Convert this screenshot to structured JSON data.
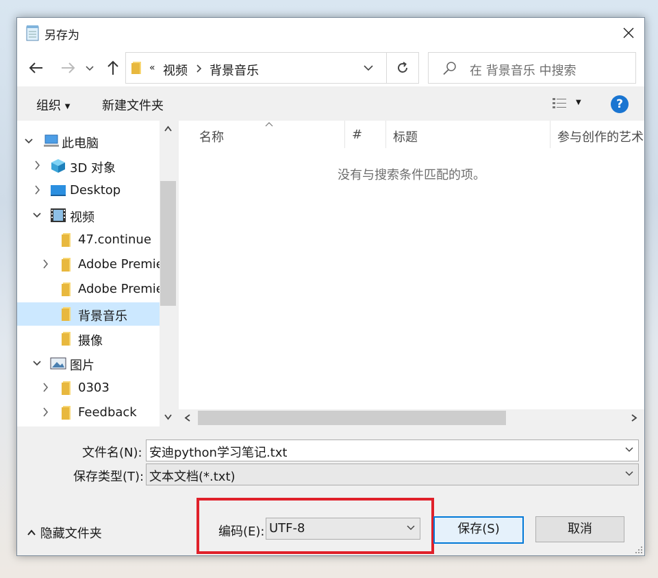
{
  "dialog": {
    "title": "另存为"
  },
  "address": {
    "overflow": "«",
    "crumbs": [
      "视频",
      "背景音乐"
    ]
  },
  "search": {
    "placeholder": "在 背景音乐 中搜索"
  },
  "toolbar": {
    "organize": "组织",
    "new_folder": "新建文件夹",
    "help": "?"
  },
  "nav": {
    "items": [
      {
        "label": "此电脑",
        "icon": "computer-icon"
      },
      {
        "label": "3D 对象",
        "icon": "3d-objects-icon"
      },
      {
        "label": "Desktop",
        "icon": "desktop-icon"
      },
      {
        "label": "视频",
        "icon": "video-folder-icon"
      },
      {
        "label": "47.continue",
        "icon": "folder-icon"
      },
      {
        "label": "Adobe Premie",
        "icon": "folder-icon"
      },
      {
        "label": "Adobe Premie",
        "icon": "folder-icon"
      },
      {
        "label": "背景音乐",
        "icon": "folder-icon"
      },
      {
        "label": "摄像",
        "icon": "folder-icon"
      },
      {
        "label": "图片",
        "icon": "pictures-icon"
      },
      {
        "label": "0303",
        "icon": "folder-icon"
      },
      {
        "label": "Feedback",
        "icon": "folder-icon"
      }
    ]
  },
  "list": {
    "columns": [
      "名称",
      "#",
      "标题",
      "参与创作的艺术"
    ],
    "empty_message": "没有与搜索条件匹配的项。"
  },
  "form": {
    "filename_label": "文件名(N):",
    "filename_value": "安迪python学习笔记.txt",
    "filetype_label": "保存类型(T):",
    "filetype_value": "文本文档(*.txt)",
    "encoding_label": "编码(E):",
    "encoding_value": "UTF-8"
  },
  "footer": {
    "hide_folders": "隐藏文件夹",
    "save_label": "保存(S)",
    "cancel_label": "取消"
  },
  "colors": {
    "accent": "#0078d7",
    "highlight_box": "#e0202a",
    "selected_row": "#cce8ff"
  }
}
